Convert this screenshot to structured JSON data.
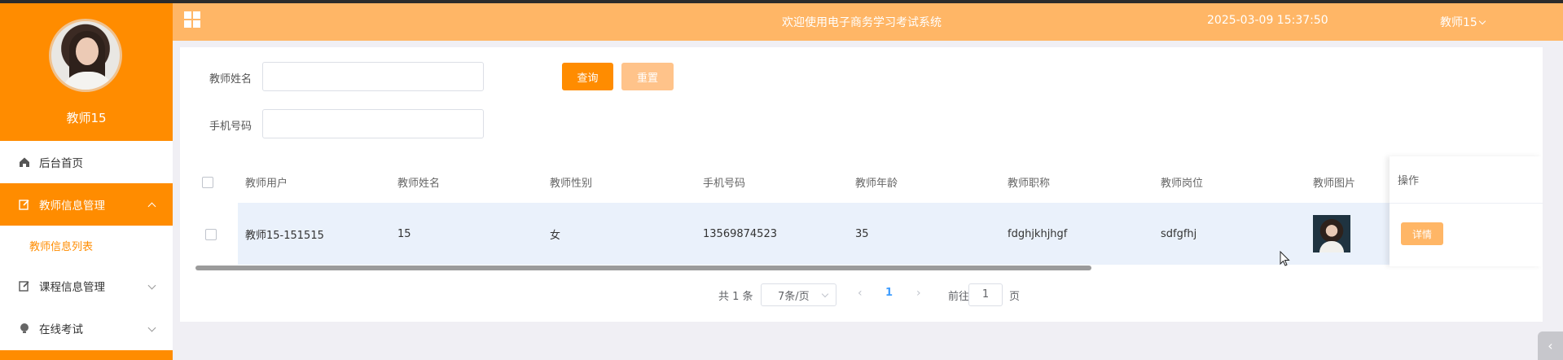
{
  "app": {
    "header_title": "欢迎使用电子商务学习考试系统",
    "datetime": "2025-03-09 15:37:50",
    "username": "教师15"
  },
  "sidebar": {
    "profile_name": "教师15",
    "items": [
      {
        "label": "后台首页",
        "icon": "home-icon"
      },
      {
        "label": "教师信息管理",
        "icon": "edit-icon"
      },
      {
        "label": "课程信息管理",
        "icon": "edit-icon"
      },
      {
        "label": "在线考试",
        "icon": "bulb-icon"
      }
    ],
    "submenu": {
      "label": "教师信息列表"
    }
  },
  "search": {
    "name_label": "教师姓名",
    "name_value": "",
    "phone_label": "手机号码",
    "phone_value": "",
    "query_button": "查询",
    "reset_button": "重置"
  },
  "table": {
    "headers": [
      "教师用户",
      "教师姓名",
      "教师性别",
      "手机号码",
      "教师年龄",
      "教师职称",
      "教师岗位",
      "教师图片",
      "操作"
    ],
    "rows": [
      {
        "user": "教师15-151515",
        "name": "15",
        "gender": "女",
        "phone": "13569874523",
        "age": "35",
        "title": "fdghjkhjhgf",
        "post": "sdfgfhj",
        "action": "详情"
      }
    ]
  },
  "pagination": {
    "total": "共 1 条",
    "page_size": "7条/页",
    "current_page": "1",
    "goto_prefix": "前往",
    "goto_value": "1",
    "goto_suffix": "页"
  },
  "colors": {
    "accent": "#ff8c00",
    "header": "#ffb666",
    "reset": "#ffc38a"
  }
}
